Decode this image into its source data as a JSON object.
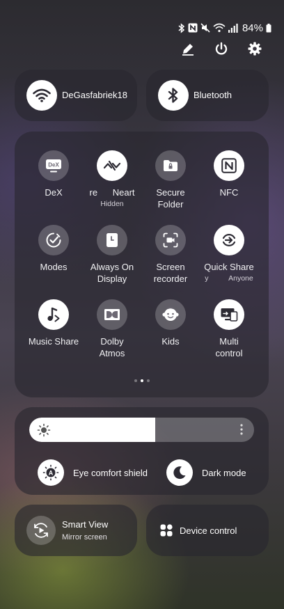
{
  "status_bar": {
    "battery_percent": "84%",
    "icons": [
      "bluetooth-icon",
      "nfc-icon",
      "mute-icon",
      "wifi-icon",
      "signal-icon",
      "battery-icon"
    ]
  },
  "top_actions": [
    {
      "name": "edit-icon"
    },
    {
      "name": "power-icon"
    },
    {
      "name": "settings-icon"
    }
  ],
  "wifi": {
    "label": "DeGasfabriek18",
    "on": true
  },
  "bluetooth": {
    "label": "Bluetooth",
    "on": true
  },
  "quick_settings": [
    {
      "id": "dex",
      "label": "DeX",
      "sub": "",
      "on": false
    },
    {
      "id": "nearby",
      "label": "re      Neart",
      "sub": "Hidden",
      "on": true
    },
    {
      "id": "secure-folder",
      "label": "Secure\nFolder",
      "sub": "",
      "on": false
    },
    {
      "id": "nfc",
      "label": "NFC",
      "sub": "",
      "on": true
    },
    {
      "id": "modes",
      "label": "Modes",
      "sub": "",
      "on": false
    },
    {
      "id": "always-on",
      "label": "Always On\nDisplay",
      "sub": "",
      "on": false
    },
    {
      "id": "screen-recorder",
      "label": "Screen\nrecorder",
      "sub": "",
      "on": false
    },
    {
      "id": "quick-share",
      "label": "Quick Share",
      "sub": "y          Anyone",
      "on": true
    },
    {
      "id": "music-share",
      "label": "Music Share",
      "sub": "",
      "on": true
    },
    {
      "id": "dolby",
      "label": "Dolby\nAtmos",
      "sub": "",
      "on": false
    },
    {
      "id": "kids",
      "label": "Kids",
      "sub": "",
      "on": false
    },
    {
      "id": "multi-control",
      "label": "Multi\ncontrol",
      "sub": "",
      "on": true
    }
  ],
  "page_indicator": {
    "count": 3,
    "active": 1
  },
  "brightness": {
    "level": 0.56
  },
  "display_options": {
    "eye_comfort": "Eye comfort shield",
    "dark_mode": "Dark mode"
  },
  "smart_view": {
    "title": "Smart View",
    "subtitle": "Mirror screen"
  },
  "device_control": {
    "label": "Device control"
  },
  "colors": {
    "tile_on": "#ffffff",
    "tile_off": "rgba(255,255,255,0.22)",
    "icon_dark": "#2c2a33"
  }
}
